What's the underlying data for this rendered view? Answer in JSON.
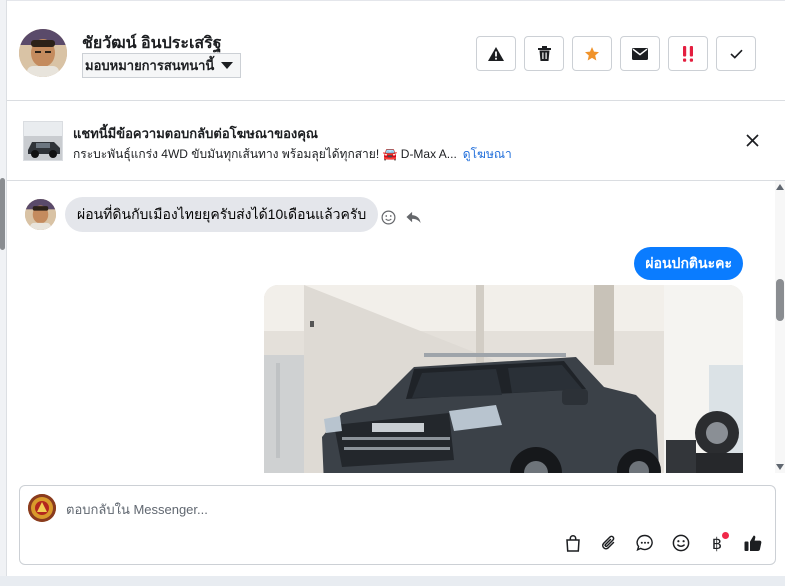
{
  "header": {
    "contact_name": "ชัยวัฒน์ อินประเสริฐ",
    "assign_label": "มอบหมายการสนทนานี้",
    "actions": [
      {
        "name": "report-icon",
        "label": "!"
      },
      {
        "name": "trash-icon",
        "label": ""
      },
      {
        "name": "star-icon",
        "label": ""
      },
      {
        "name": "mail-icon",
        "label": ""
      },
      {
        "name": "urgent-icon",
        "label": "!!"
      },
      {
        "name": "check-icon",
        "label": ""
      }
    ],
    "colors": {
      "star": "#f0932b",
      "urgent": "#e41e3f"
    }
  },
  "ad_banner": {
    "title": "แชทนี้มีข้อความตอบกลับต่อโฆษณาของคุณ",
    "subtitle": "กระบะพันธุ์แกร่ง 4WD ขับมันทุกเส้นทาง พร้อมลุยได้ทุกสาย! 🚘 D-Max A...",
    "link": "ดูโฆษณา"
  },
  "messages": {
    "incoming": "ผ่อนที่ดินกับเมืองไทยยุครับส่งได้10เดือนแล้วครับ",
    "outgoing": "ผ่อนปกตินะคะ",
    "photo_icon": "pickup-truck-photo"
  },
  "composer": {
    "placeholder": "ตอบกลับใน Messenger...",
    "tools": [
      "shopping-bag-icon",
      "paperclip-icon",
      "quick-reply-icon",
      "emoji-icon",
      "baht-payment-icon",
      "thumbs-up-icon"
    ],
    "baht_symbol": "฿"
  },
  "colors": {
    "accent": "#0a7cff",
    "link": "#216fdb",
    "bubble_in": "#e4e6eb"
  }
}
